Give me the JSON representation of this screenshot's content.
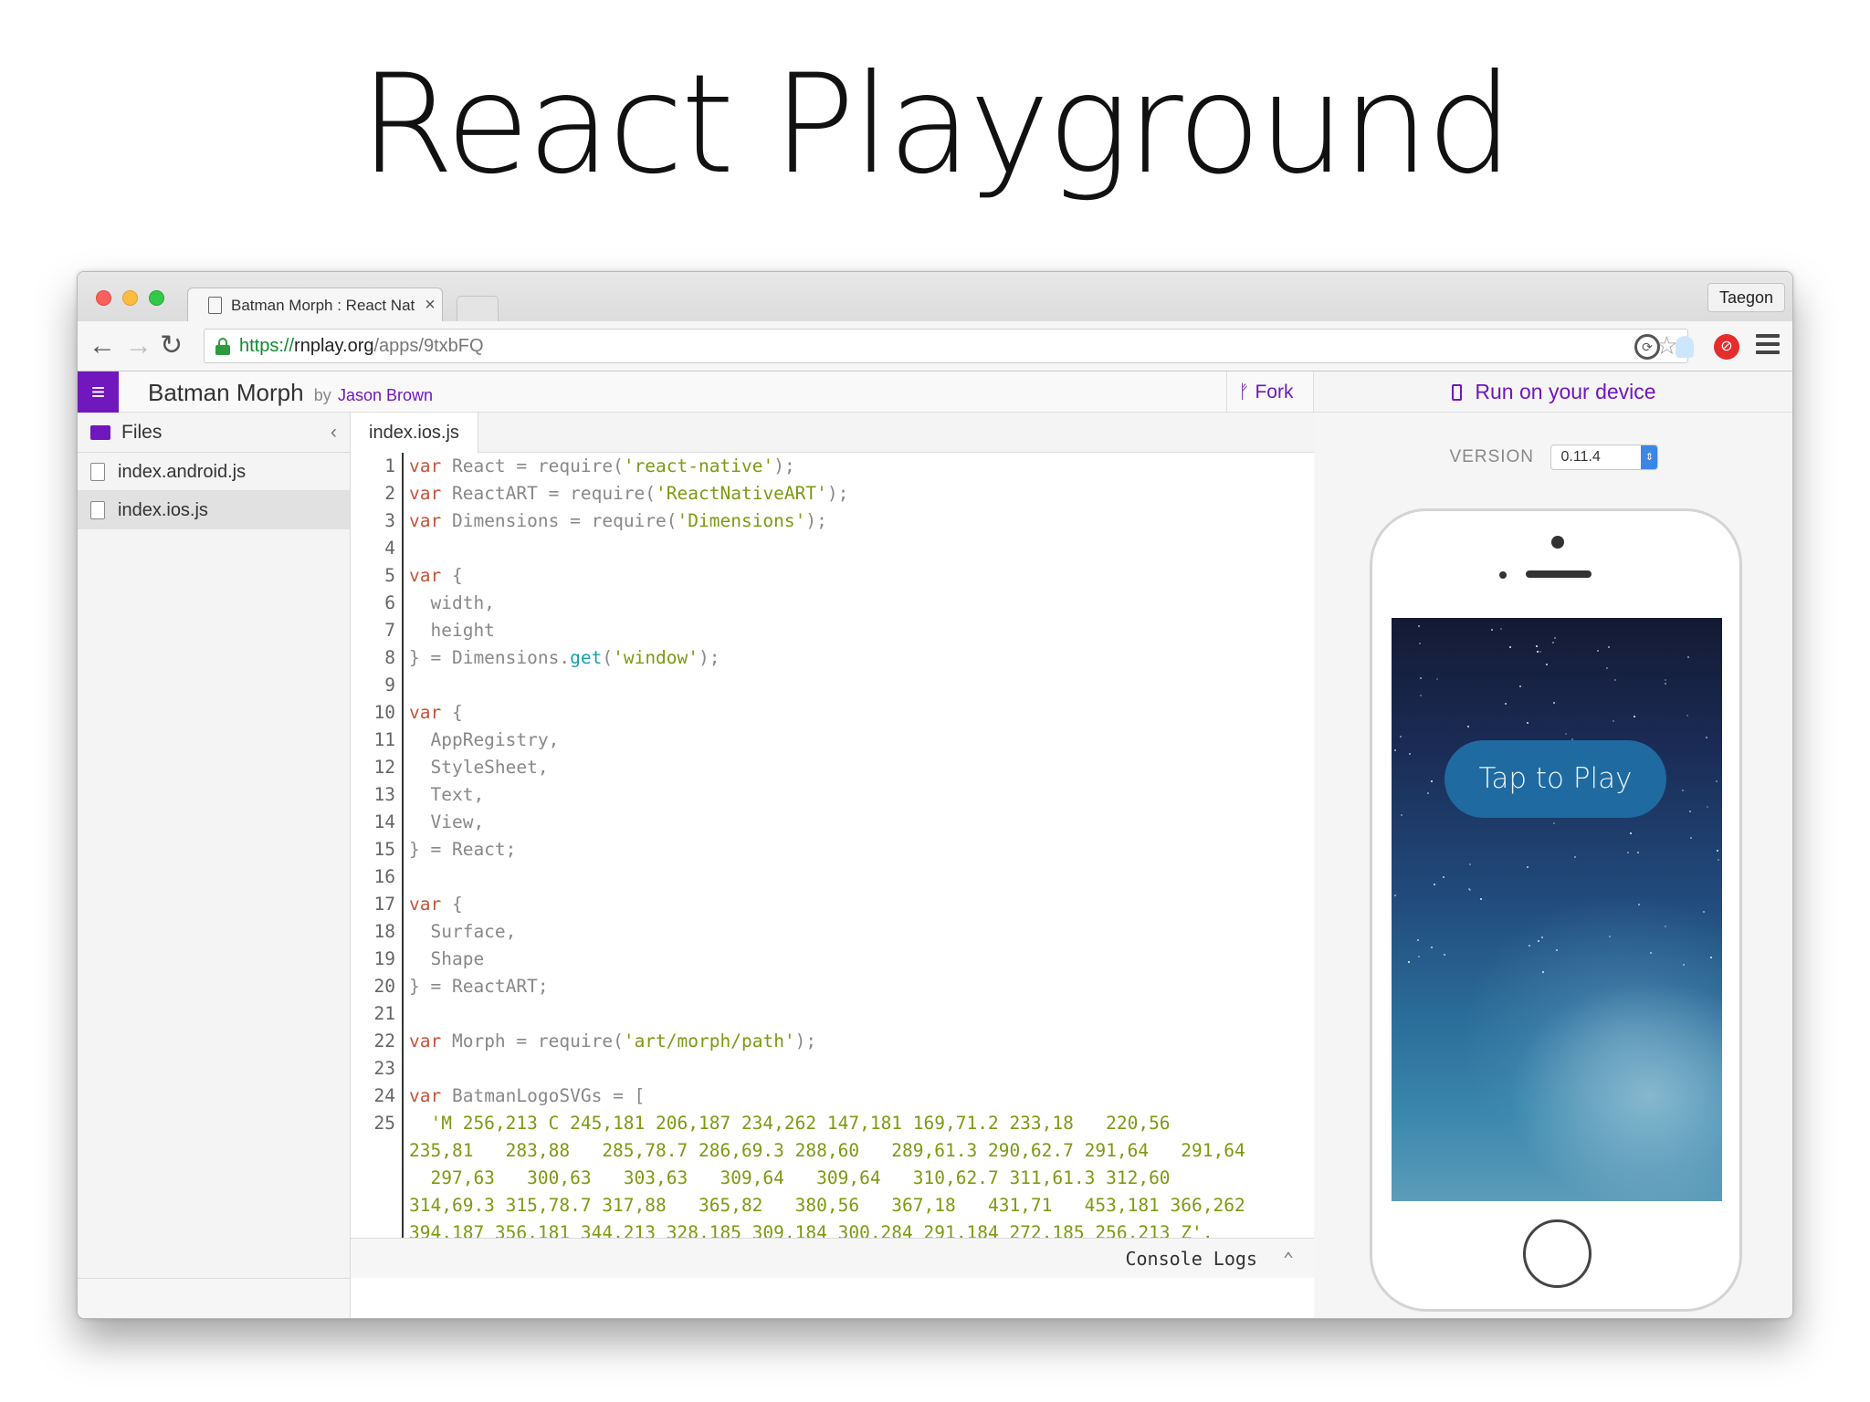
{
  "slide": {
    "title": "React Playground"
  },
  "browser": {
    "tab_title": "Batman Morph : React Nat",
    "tab_close": "×",
    "profile_name": "Taegon",
    "url_scheme": "https://",
    "url_host": "rnplay.org",
    "url_path": "/apps/9txbFQ"
  },
  "app": {
    "menu_icon": "≡",
    "project_title": "Batman Morph",
    "by": "by",
    "author": "Jason Brown",
    "fork_label": "Fork",
    "fork_icon": "ᚠ"
  },
  "sidebar": {
    "header": "Files",
    "collapse_icon": "‹",
    "files": [
      {
        "name": "index.android.js"
      },
      {
        "name": "index.ios.js"
      }
    ]
  },
  "editor": {
    "tab": "index.ios.js",
    "line_numbers": [
      "1",
      "2",
      "3",
      "4",
      "5",
      "6",
      "7",
      "8",
      "9",
      "10",
      "11",
      "12",
      "13",
      "14",
      "15",
      "16",
      "17",
      "18",
      "19",
      "20",
      "21",
      "22",
      "23",
      "24",
      "25"
    ],
    "console_label": "Console Logs",
    "console_caret": "⌃"
  },
  "code": {
    "l1": {
      "kw": "var",
      "id": " React = require(",
      "str": "'react-native'",
      "end": ");"
    },
    "l2": {
      "kw": "var",
      "id": " ReactART = require(",
      "str": "'ReactNativeART'",
      "end": ");"
    },
    "l3": {
      "kw": "var",
      "id": " Dimensions = require(",
      "str": "'Dimensions'",
      "end": ");"
    },
    "l5": {
      "kw": "var",
      "id": " {"
    },
    "l6": "  width,",
    "l7": "  height",
    "l8": {
      "pre": "} = Dimensions.",
      "fn": "get",
      "mid": "(",
      "str": "'window'",
      "end": ");"
    },
    "l10": {
      "kw": "var",
      "id": " {"
    },
    "l11": "  AppRegistry,",
    "l12": "  StyleSheet,",
    "l13": "  Text,",
    "l14": "  View,",
    "l15": "} = React;",
    "l17": {
      "kw": "var",
      "id": " {"
    },
    "l18": "  Surface,",
    "l19": "  Shape",
    "l20": "} = ReactART;",
    "l22": {
      "kw": "var",
      "id": " Morph = require(",
      "str": "'art/morph/path'",
      "end": ");"
    },
    "l24": {
      "kw": "var",
      "id": " BatmanLogoSVGs = ["
    },
    "l25_lines": [
      "  'M 256,213 C 245,181 206,187 234,262 147,181 169,71.2 233,18   220,56",
      "235,81   283,88   285,78.7 286,69.3 288,60   289,61.3 290,62.7 291,64   291,64",
      "  297,63   300,63   303,63   309,64   309,64   310,62.7 311,61.3 312,60",
      "314,69.3 315,78.7 317,88   365,82   380,56   367,18   431,71   453,181 366,262",
      "394,187 356,181 344,213 328,185 309,184 300,284 291,184 272,185 256,213 Z',"
    ]
  },
  "device_panel": {
    "run_label": "Run on your device",
    "version_label": "VERSION",
    "version_value": "0.11.4",
    "select_arrow": "⇕",
    "phone_button": "Tap to Play"
  },
  "colors": {
    "brand_purple": "#7017bd",
    "keyword": "#c7533a",
    "string": "#7c9a12",
    "function": "#18a0a8"
  }
}
